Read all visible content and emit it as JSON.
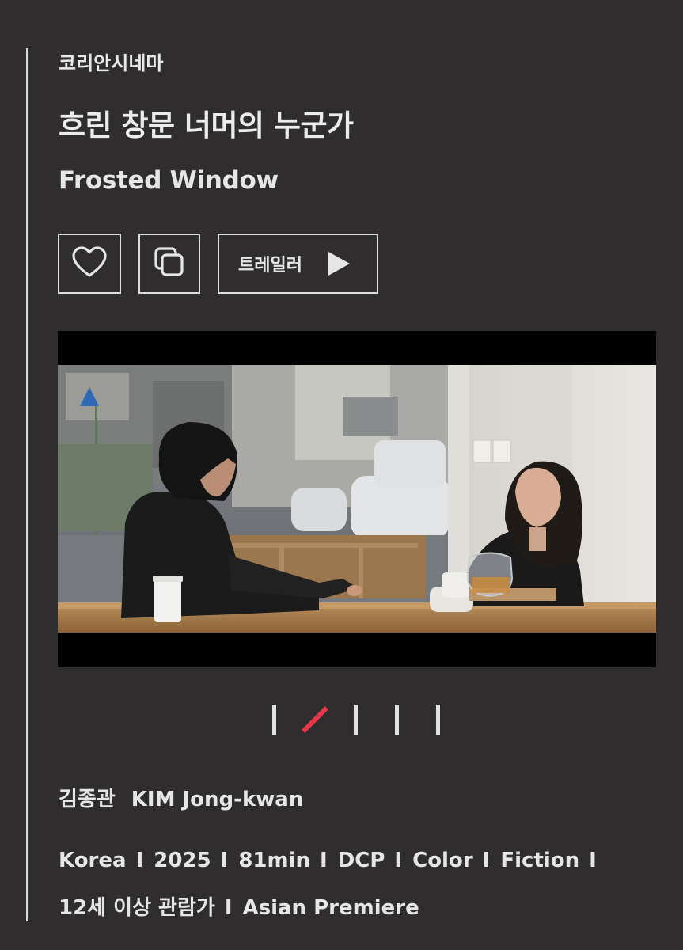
{
  "section": "코리안시네마",
  "title_ko": "흐린 창문 너머의 누군가",
  "title_en": "Frosted Window",
  "actions": {
    "like_icon": "heart-icon",
    "share_icon": "copy-icon",
    "trailer_label": "트레일러",
    "trailer_icon": "play-icon"
  },
  "gallery": {
    "image_icon": "film-still",
    "slide_count": 5,
    "active_slide": 2
  },
  "director": {
    "name_ko": "김종관",
    "name_en": "KIM Jong-kwan"
  },
  "info": {
    "country": "Korea",
    "year": "2025",
    "runtime": "81min",
    "format": "DCP",
    "color": "Color",
    "genre": "Fiction",
    "rating": "12세 이상 관람가",
    "premiere": "Asian Premiere",
    "separator": "I"
  },
  "colors": {
    "background": "#2f2d2e",
    "text": "#e6e6e6",
    "active_indicator": "#e63647"
  }
}
